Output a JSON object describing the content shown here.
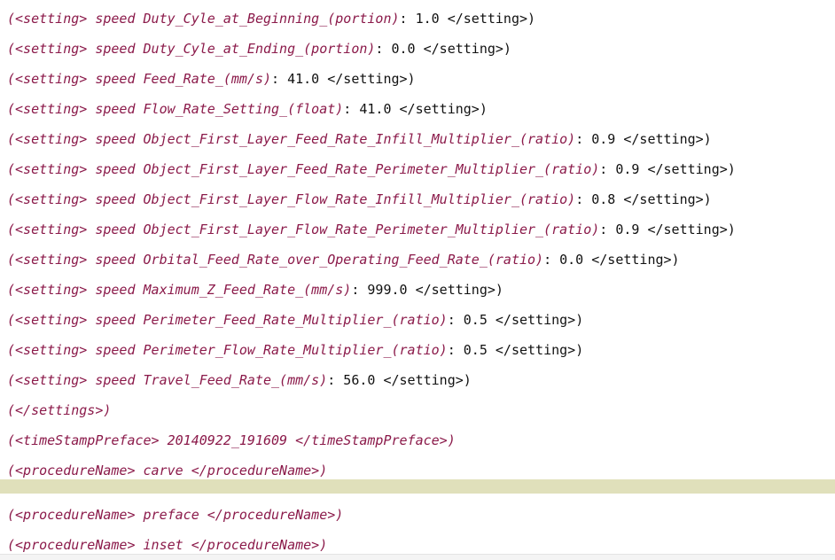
{
  "lines": [
    {
      "tag": "(<setting> speed Duty_Cyle_at_Beginning_(portion)",
      "rest": ": 1.0 </setting>)"
    },
    {
      "tag": "(<setting> speed Duty_Cyle_at_Ending_(portion)",
      "rest": ": 0.0 </setting>)"
    },
    {
      "tag": "(<setting> speed Feed_Rate_(mm/s)",
      "rest": ": 41.0 </setting>)"
    },
    {
      "tag": "(<setting> speed Flow_Rate_Setting_(float)",
      "rest": ": 41.0 </setting>)"
    },
    {
      "tag": "(<setting> speed Object_First_Layer_Feed_Rate_Infill_Multiplier_(ratio)",
      "rest": ": 0.9 </setting>)"
    },
    {
      "tag": "(<setting> speed Object_First_Layer_Feed_Rate_Perimeter_Multiplier_(ratio)",
      "rest": ": 0.9 </setting>)"
    },
    {
      "tag": "(<setting> speed Object_First_Layer_Flow_Rate_Infill_Multiplier_(ratio)",
      "rest": ": 0.8 </setting>)"
    },
    {
      "tag": "(<setting> speed Object_First_Layer_Flow_Rate_Perimeter_Multiplier_(ratio)",
      "rest": ": 0.9 </setting>)"
    },
    {
      "tag": "(<setting> speed Orbital_Feed_Rate_over_Operating_Feed_Rate_(ratio)",
      "rest": ": 0.0 </setting>)"
    },
    {
      "tag": "(<setting> speed Maximum_Z_Feed_Rate_(mm/s)",
      "rest": ": 999.0 </setting>)"
    },
    {
      "tag": "(<setting> speed Perimeter_Feed_Rate_Multiplier_(ratio)",
      "rest": ": 0.5 </setting>)"
    },
    {
      "tag": "(<setting> speed Perimeter_Flow_Rate_Multiplier_(ratio)",
      "rest": ": 0.5 </setting>)"
    },
    {
      "tag": "(<setting> speed Travel_Feed_Rate_(mm/s)",
      "rest": ": 56.0 </setting>)"
    },
    {
      "tag": "(</settings>)",
      "rest": ""
    },
    {
      "tag": "(<timeStampPreface> 20140922_191609 </timeStampPreface>)",
      "rest": ""
    },
    {
      "tag": "(<procedureName> carve </procedureName>)",
      "rest": ""
    },
    {
      "tag": "(<procedureName> preface </procedureName>)",
      "rest": ""
    },
    {
      "tag": "(<procedureName> inset </procedureName>)",
      "rest": ""
    }
  ]
}
